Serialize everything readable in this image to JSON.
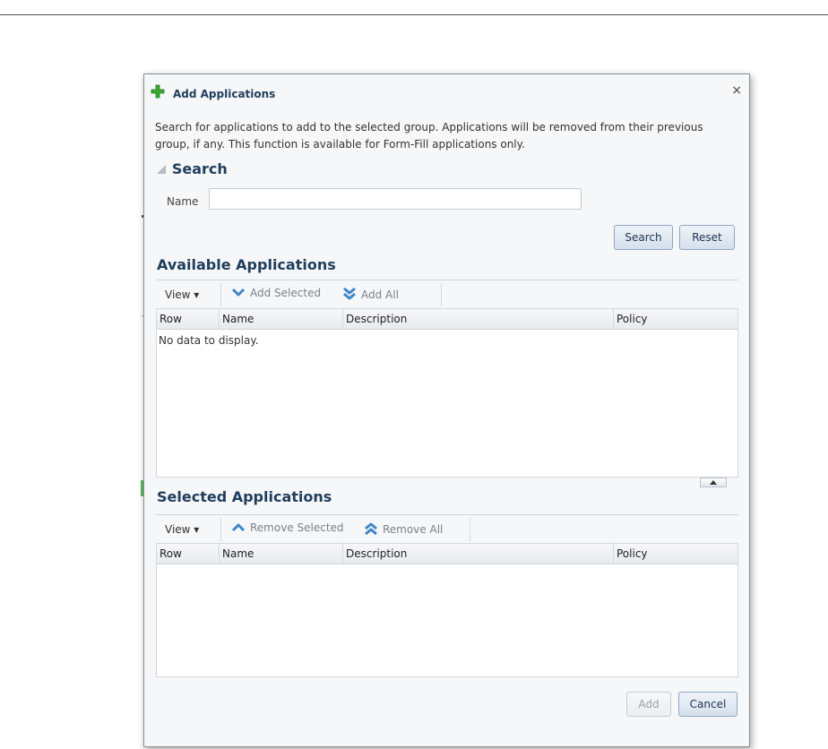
{
  "dialog": {
    "title": "Add Applications",
    "close_symbol": "×",
    "intro": "Search for applications to add to the selected group. Applications will be removed from their previous group, if any. This function is available for Form-Fill applications only."
  },
  "search": {
    "title": "Search",
    "name_label": "Name",
    "name_value": "",
    "search_button": "Search",
    "reset_button": "Reset"
  },
  "available": {
    "title": "Available Applications",
    "toolbar": {
      "view": "View ▾",
      "add_selected": "Add Selected",
      "add_all": "Add All"
    },
    "columns": [
      "Row",
      "Name",
      "Description",
      "Policy"
    ],
    "empty_message": "No data to display."
  },
  "selected": {
    "title": "Selected Applications",
    "toolbar": {
      "view": "View ▾",
      "remove_selected": "Remove Selected",
      "remove_all": "Remove All"
    },
    "columns": [
      "Row",
      "Name",
      "Description",
      "Policy"
    ]
  },
  "footer": {
    "add_button": "Add",
    "cancel_button": "Cancel"
  },
  "icons": {
    "add": "plus-icon",
    "close": "close-icon",
    "add_selected": "chevron-down-icon",
    "add_all": "double-chevron-down-icon",
    "remove_selected": "chevron-up-icon",
    "remove_all": "double-chevron-up-icon"
  },
  "colors": {
    "heading": "#1f3d5c",
    "plus_green": "#3aaa35",
    "toolbar_icon": "#3d86c6",
    "button_border": "#8fa6c2"
  }
}
